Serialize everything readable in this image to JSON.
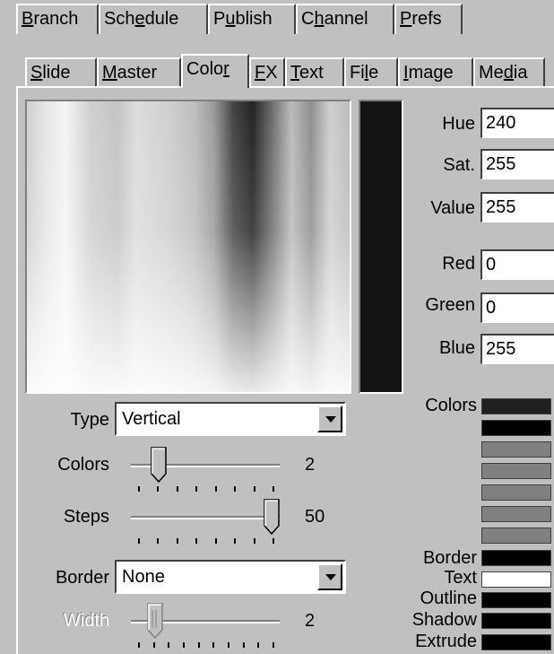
{
  "top_tabs": [
    {
      "label": "Branch",
      "key": "B"
    },
    {
      "label": "Schedule",
      "key": "e"
    },
    {
      "label": "Publish",
      "key": "u"
    },
    {
      "label": "Channel",
      "key": "h"
    },
    {
      "label": "Prefs",
      "key": "P"
    }
  ],
  "sub_tabs": [
    {
      "label": "Slide",
      "key": "S"
    },
    {
      "label": "Master",
      "key": "M"
    },
    {
      "label": "Color",
      "key": "r",
      "active": true
    },
    {
      "label": "FX",
      "key": "F"
    },
    {
      "label": "Text",
      "key": "T"
    },
    {
      "label": "File",
      "key": "l"
    },
    {
      "label": "Image",
      "key": "I"
    },
    {
      "label": "Media",
      "key": "d"
    }
  ],
  "color_fields": {
    "hue": {
      "label": "Hue",
      "value": "240"
    },
    "sat": {
      "label": "Sat.",
      "value": "255"
    },
    "val": {
      "label": "Value",
      "value": "255"
    },
    "red": {
      "label": "Red",
      "value": "0"
    },
    "green": {
      "label": "Green",
      "value": "0"
    },
    "blue": {
      "label": "Blue",
      "value": "255"
    }
  },
  "gradient": {
    "type_label": "Type",
    "type_value": "Vertical",
    "colors_label": "Colors",
    "colors_value": "2",
    "colors_position": 0.15,
    "steps_label": "Steps",
    "steps_value": "50",
    "steps_position": 1.0,
    "border_label": "Border",
    "border_value": "None",
    "width_label": "Width",
    "width_value": "2",
    "width_position": 0.12
  },
  "swatches": {
    "colors_label": "Colors",
    "list": [
      "#202020",
      "#000000",
      "#808080",
      "#808080",
      "#808080",
      "#808080",
      "#808080"
    ],
    "border_label": "Border",
    "border_color": "#000000",
    "text_label": "Text",
    "text_color": "#ffffff",
    "outline_label": "Outline",
    "outline_color": "#000000",
    "shadow_label": "Shadow",
    "shadow_color": "#000000",
    "extrude_label": "Extrude",
    "extrude_color": "#000000"
  },
  "preview_color": "#141414"
}
